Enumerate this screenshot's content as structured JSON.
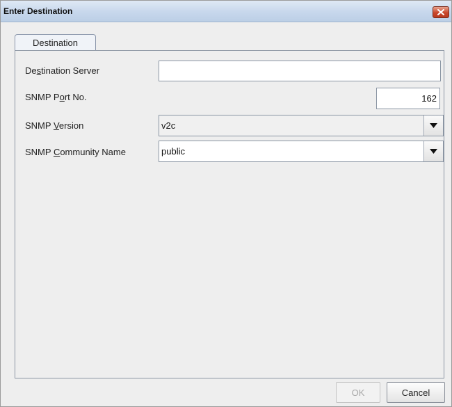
{
  "window": {
    "title": "Enter Destination",
    "close_icon": "close-icon"
  },
  "tabs": [
    {
      "label": "Destination",
      "selected": true
    }
  ],
  "form": {
    "destination_server": {
      "label_pre": "De",
      "label_mn": "s",
      "label_post": "tination Server",
      "value": ""
    },
    "snmp_port": {
      "label_pre": "SNMP P",
      "label_mn": "o",
      "label_post": "rt No.",
      "value": "162"
    },
    "snmp_version": {
      "label_pre": "SNMP ",
      "label_mn": "V",
      "label_post": "ersion",
      "value": "v2c"
    },
    "snmp_community": {
      "label_pre": "SNMP ",
      "label_mn": "C",
      "label_post": "ommunity Name",
      "value": "public"
    }
  },
  "buttons": {
    "ok_label": "OK",
    "cancel_label": "Cancel"
  },
  "colors": {
    "titlebar": "#c7d7ec",
    "close_button": "#c9462b",
    "dialog_bg": "#eeeeee"
  }
}
